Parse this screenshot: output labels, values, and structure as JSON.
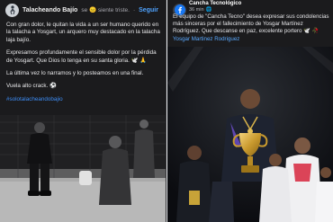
{
  "left_post": {
    "author": "Talacheando Bajío",
    "feeling": "se 😐 siente triste.",
    "dot": "·",
    "follow_label": "Seguir",
    "paragraph_1": "Con gran dolor, le quitan la vida a un ser humano querido en la talacha a Yosgart, un arquero muy destacado en la talacha laja bajío.",
    "paragraph_2": "Expresamos profundamente el sensible dolor por la pérdida de Yosgart. Que Dios lo tenga en su santa gloria. 🕊️ 🙏",
    "paragraph_3": "La última vez lo narramos y lo posteamos en una final.",
    "paragraph_4": "Vuela alto crack. ⚽",
    "hashtag": "#solotalacheandobajio"
  },
  "right_post": {
    "page_name": "Cancha Tecnológico",
    "timestamp": "36 min",
    "globe_icon": "🌐",
    "text_main": "El equipo de \"Cancha Tecno\" desea expresar sus condolencias más sinceras por el fallecimiento de Yosgar Martínez Rodríguez. Que descanse en paz, excelente portero 🕊️ 🥀",
    "mention": "Yosgar Martinez Rodriguez"
  },
  "colors": {
    "panel_bg": "#1b1b1d",
    "link_blue": "#4fa3ff"
  }
}
